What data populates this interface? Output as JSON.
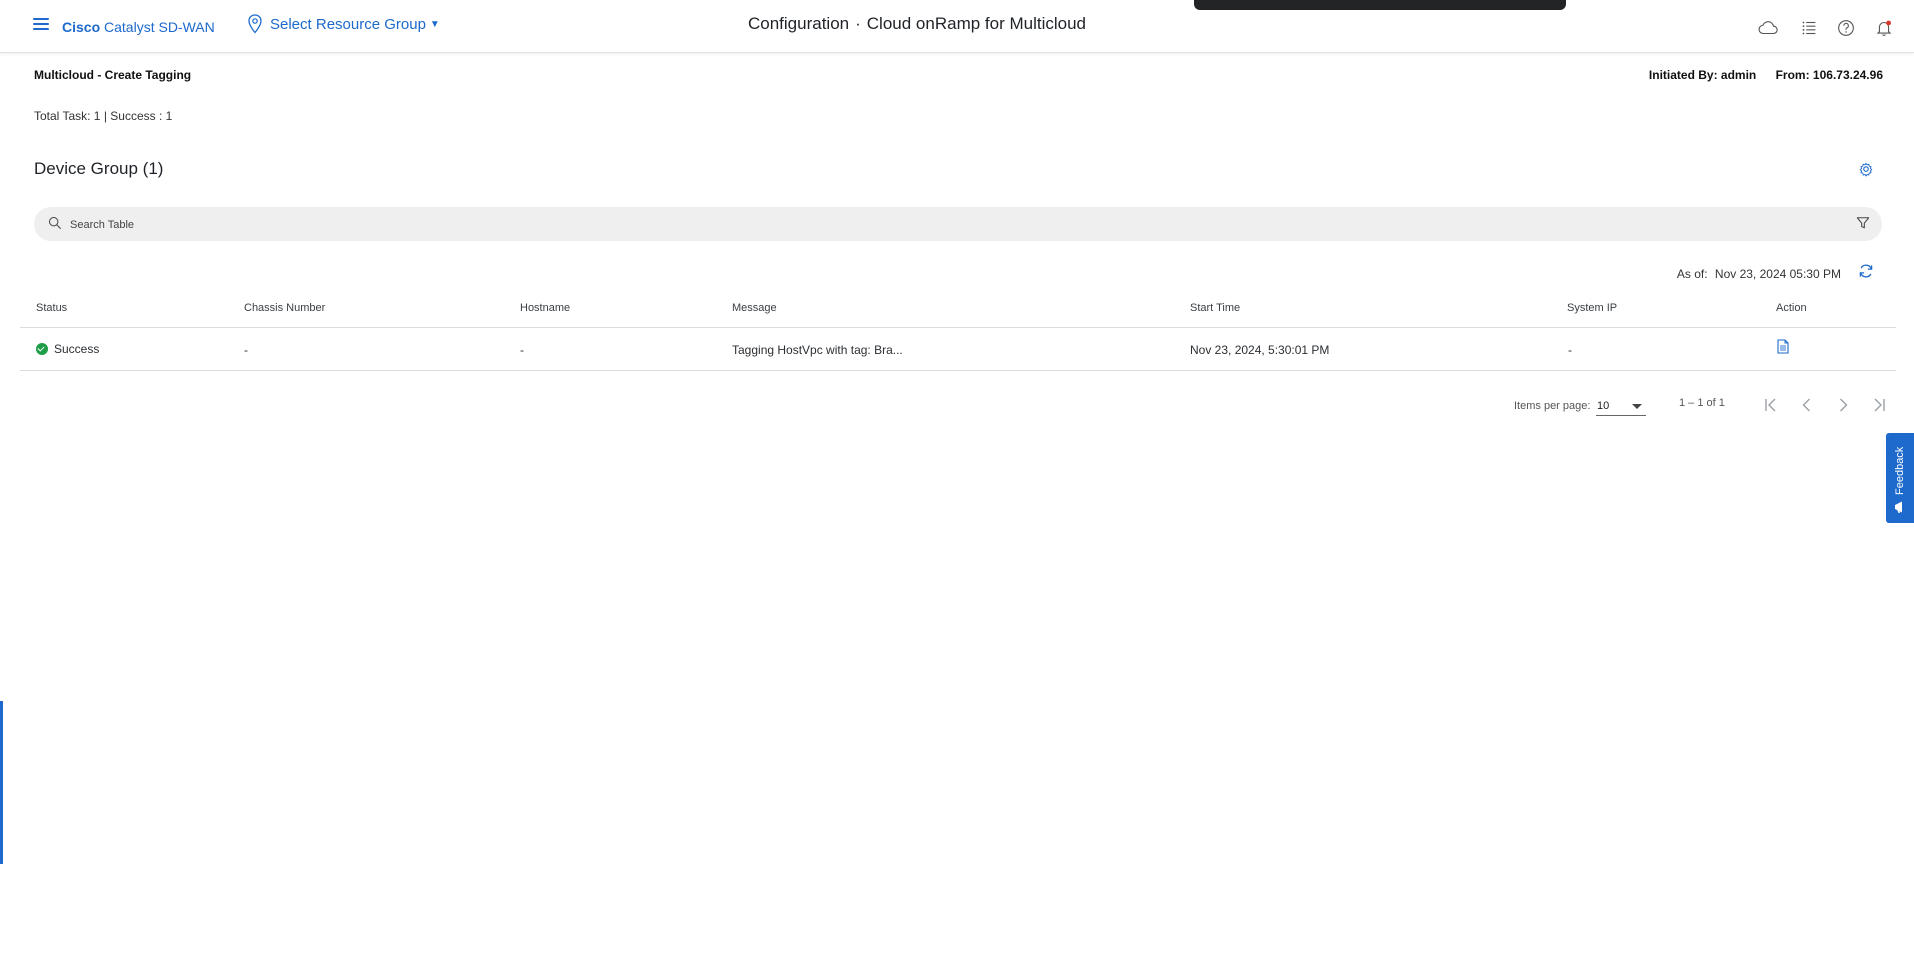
{
  "header": {
    "brand_bold": "Cisco",
    "brand_rest": "Catalyst SD-WAN",
    "resource_group": "Select Resource Group",
    "title_section": "Configuration",
    "title_separator": "·",
    "title_page": "Cloud onRamp for Multicloud",
    "icons": [
      "menu-icon",
      "location-pin-icon",
      "cloud-icon",
      "list-icon",
      "help-icon",
      "bell-icon"
    ]
  },
  "task": {
    "title": "Multicloud - Create Tagging",
    "initiated_by": "Initiated By: admin",
    "from": "From: 106.73.24.96",
    "totals": "Total Task: 1 | Success : 1"
  },
  "group": {
    "title": "Device Group (1)"
  },
  "search": {
    "placeholder": "Search Table"
  },
  "as_of": {
    "label": "As of:",
    "value": "Nov 23, 2024 05:30 PM"
  },
  "table": {
    "columns": [
      "Status",
      "Chassis Number",
      "Hostname",
      "Message",
      "Start Time",
      "System IP",
      "Action"
    ],
    "rows": [
      {
        "status": "Success",
        "chassis_number": "-",
        "hostname": "-",
        "message": "Tagging HostVpc with tag: Bra...",
        "start_time": "Nov 23, 2024, 5:30:01 PM",
        "system_ip": "-",
        "action_icon": "document-icon"
      }
    ]
  },
  "pagination": {
    "items_per_page_label": "Items per page:",
    "items_per_page": "10",
    "range": "1 – 1 of 1"
  },
  "feedback": {
    "label": "Feedback"
  },
  "colors": {
    "accent": "#1d69cc",
    "success": "#1e9e47",
    "search_bg": "#efefef"
  }
}
